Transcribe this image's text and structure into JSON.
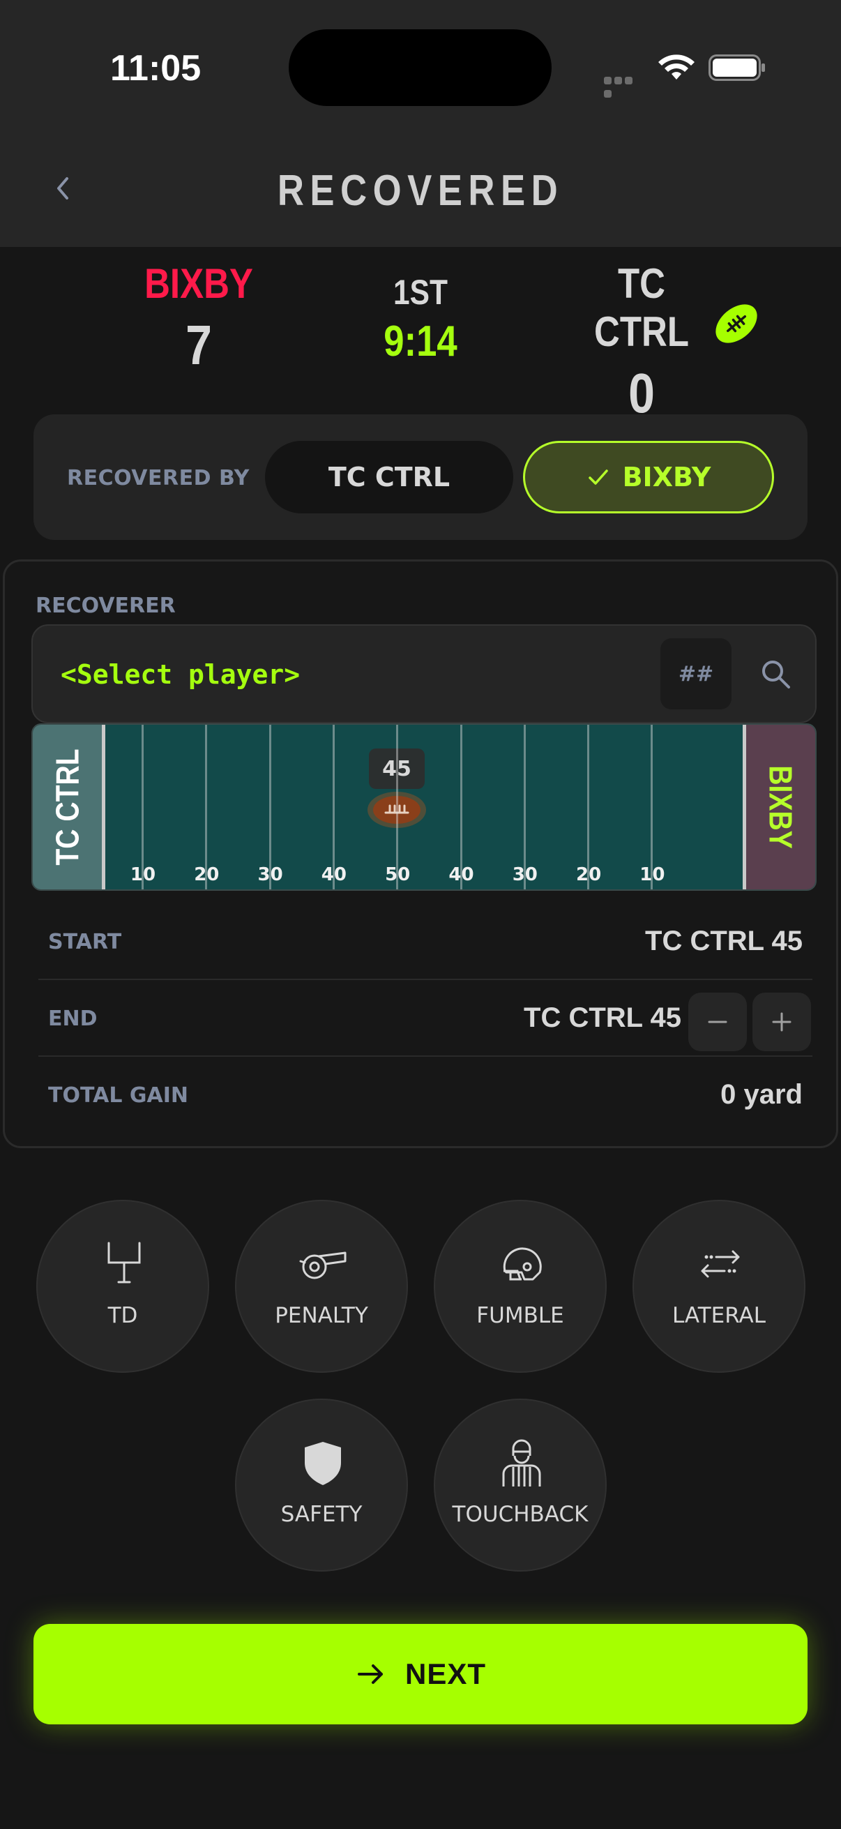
{
  "status_bar": {
    "time": "11:05"
  },
  "header": {
    "title": "RECOVERED"
  },
  "scoreboard": {
    "home": {
      "name": "BIXBY",
      "score": "7"
    },
    "away": {
      "name": "TC CTRL",
      "score": "0"
    },
    "period": "1ST",
    "clock": "9:14"
  },
  "recovered_by": {
    "label": "RECOVERED BY",
    "options": [
      "TC CTRL",
      "BIXBY"
    ],
    "selected": "BIXBY"
  },
  "recoverer": {
    "label": "RECOVERER",
    "placeholder": "<Select player>",
    "jersey_button": "##"
  },
  "field": {
    "left_endzone": "TC CTRL",
    "right_endzone": "BIXBY",
    "yard_labels": [
      "10",
      "20",
      "30",
      "40",
      "50",
      "40",
      "30",
      "20",
      "10"
    ],
    "ball_yard": "45"
  },
  "stats": {
    "start": {
      "label": "START",
      "value": "TC CTRL 45"
    },
    "end": {
      "label": "END",
      "value": "TC CTRL 45"
    },
    "total_gain": {
      "label": "TOTAL GAIN",
      "value": "0 yard"
    }
  },
  "actions": [
    {
      "label": "TD",
      "icon": "goalpost-icon"
    },
    {
      "label": "PENALTY",
      "icon": "whistle-icon"
    },
    {
      "label": "FUMBLE",
      "icon": "helmet-icon"
    },
    {
      "label": "LATERAL",
      "icon": "lateral-arrows-icon"
    },
    {
      "label": "SAFETY",
      "icon": "shield-icon"
    },
    {
      "label": "TOUCHBACK",
      "icon": "referee-icon"
    }
  ],
  "next_button": {
    "label": "NEXT"
  },
  "colors": {
    "accent": "#a6ff00",
    "home_team": "#ff1a4a",
    "field": "#124a4a"
  }
}
